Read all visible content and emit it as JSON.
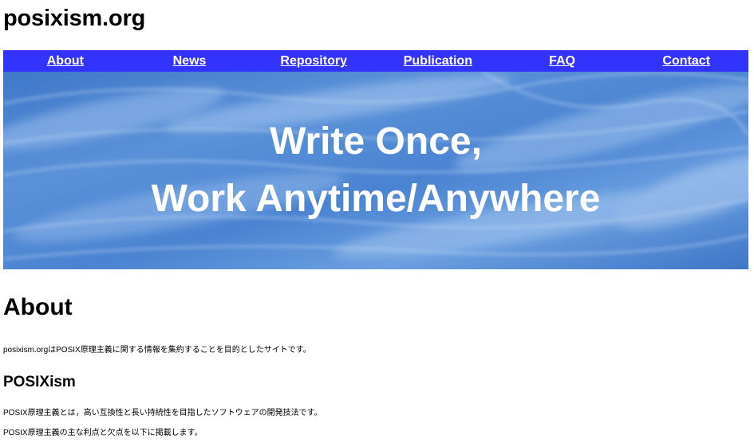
{
  "site": {
    "title": "posixism.org"
  },
  "nav": {
    "items": [
      {
        "label": "About"
      },
      {
        "label": "News"
      },
      {
        "label": "Repository"
      },
      {
        "label": "Publication"
      },
      {
        "label": "FAQ"
      },
      {
        "label": "Contact"
      }
    ],
    "background_color": "#3333ff"
  },
  "hero": {
    "line1": "Write Once,",
    "line2": "Work Anytime/Anywhere"
  },
  "about": {
    "heading": "About",
    "intro": "posixism.orgはPOSIX原理主義に関する情報を集約することを目的としたサイトです。",
    "sub_heading": "POSIXism",
    "paragraph1": "POSIX原理主義とは，高い互換性と長い持続性を目指したソフトウェアの開発技法です。",
    "paragraph2": "POSIX原理主義の主な利点と欠点を以下に掲載します。"
  }
}
